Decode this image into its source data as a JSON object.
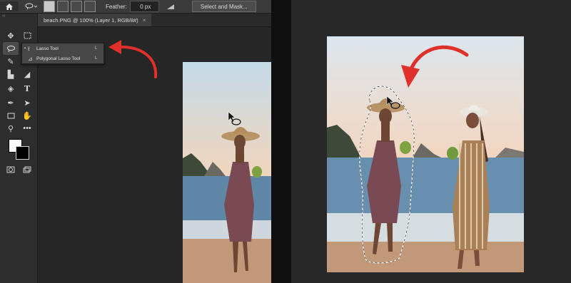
{
  "options_bar": {
    "home_icon": "home-icon",
    "tool_icon": "lasso-icon",
    "feather_label": "Feather:",
    "feather_value": "0 px",
    "select_mask_label": "Select and Mask..."
  },
  "toolbar": {
    "collapse_label": "‹‹"
  },
  "document_tab": {
    "title": "beach.PNG @ 100% (Layer 1, RGB/8#)",
    "close": "×"
  },
  "flyout": {
    "items": [
      {
        "label": "Lasso Tool",
        "shortcut": "L",
        "icon": "lasso-icon",
        "active": true,
        "bullet": "▪"
      },
      {
        "label": "Polygonal Lasso Tool",
        "shortcut": "L",
        "icon": "polygonal-lasso-icon",
        "active": false,
        "bullet": ""
      }
    ]
  },
  "colors": {
    "arrow": "#e0302a",
    "sky_top": "#c5dbe8",
    "sky_bottom": "#f1d5bd",
    "sea": "#5f88a6",
    "sand": "#c29978"
  }
}
